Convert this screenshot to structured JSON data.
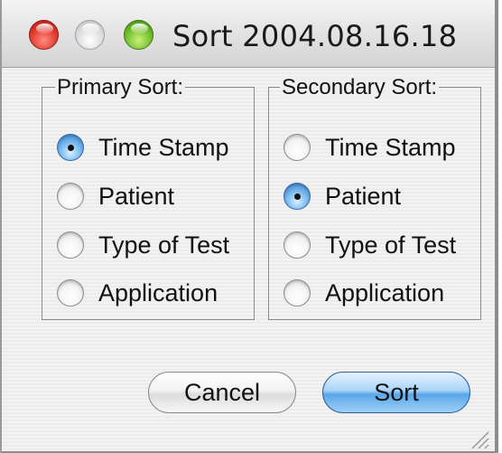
{
  "window": {
    "title": "Sort 2004.08.16.18"
  },
  "primary": {
    "legend": "Primary Sort:",
    "options": [
      {
        "label": "Time Stamp",
        "checked": true
      },
      {
        "label": "Patient",
        "checked": false
      },
      {
        "label": "Type of Test",
        "checked": false
      },
      {
        "label": "Application",
        "checked": false
      }
    ]
  },
  "secondary": {
    "legend": "Secondary Sort:",
    "options": [
      {
        "label": "Time Stamp",
        "checked": false
      },
      {
        "label": "Patient",
        "checked": true
      },
      {
        "label": "Type of Test",
        "checked": false
      },
      {
        "label": "Application",
        "checked": false
      }
    ]
  },
  "buttons": {
    "cancel": "Cancel",
    "sort": "Sort"
  },
  "colors": {
    "default_button": "#5aa6e8",
    "close_button": "#e03a2c",
    "zoom_button": "#6fbd2a"
  }
}
